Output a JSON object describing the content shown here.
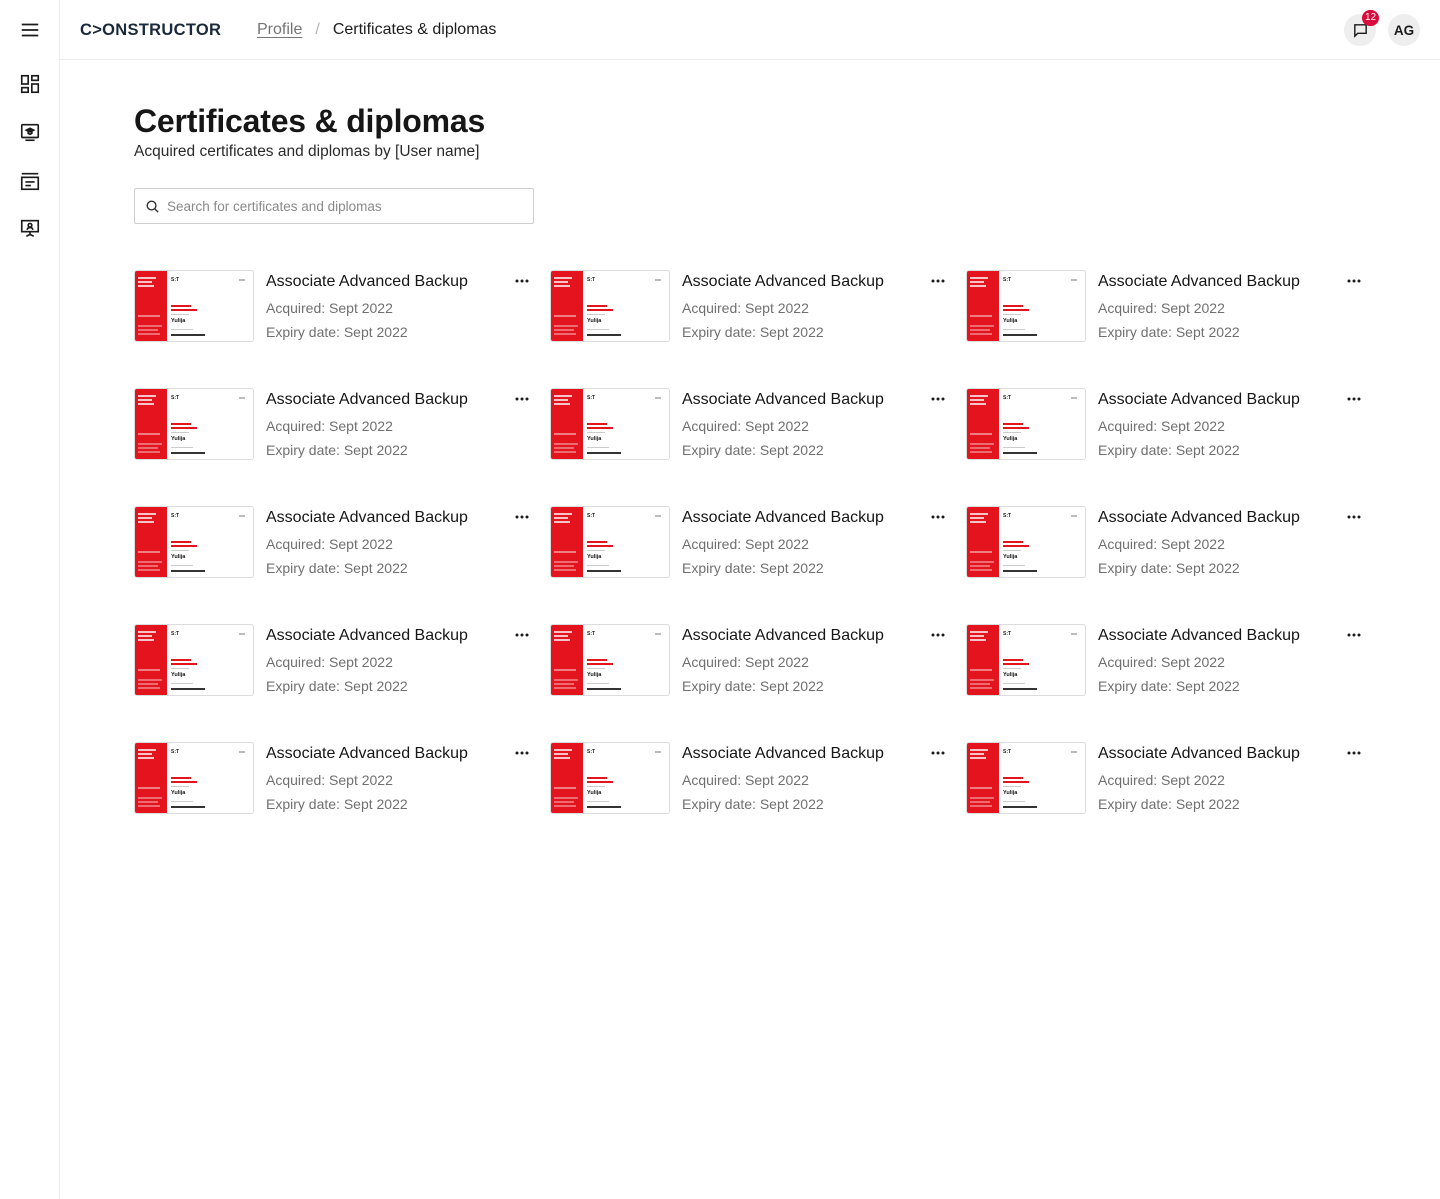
{
  "header": {
    "logo": "C>ONSTRUCTOR",
    "breadcrumb": {
      "parent": "Profile",
      "separator": "/",
      "current": "Certificates & diplomas"
    },
    "notifications_count": "12",
    "avatar_initials": "AG"
  },
  "page": {
    "title": "Certificates & diplomas",
    "subtitle": "Acquired certificates and diplomas by [User name]"
  },
  "search": {
    "placeholder": "Search for certificates and diplomas",
    "value": ""
  },
  "colors": {
    "accent": "#e3141e",
    "badge": "#d80b3c",
    "brand": "#1b2a3a"
  },
  "certificates": [
    {
      "title": "Associate Advanced Backup",
      "acquired": "Acquired: Sept 2022",
      "expiry": "Expiry date: Sept 2022",
      "thumb_logo": "S:T",
      "thumb_name": "Yulija"
    },
    {
      "title": "Associate Advanced Backup",
      "acquired": "Acquired: Sept 2022",
      "expiry": "Expiry date: Sept 2022",
      "thumb_logo": "S:T",
      "thumb_name": "Yulija"
    },
    {
      "title": "Associate Advanced Backup",
      "acquired": "Acquired: Sept 2022",
      "expiry": "Expiry date: Sept 2022",
      "thumb_logo": "S:T",
      "thumb_name": "Yulija"
    },
    {
      "title": "Associate Advanced Backup",
      "acquired": "Acquired: Sept 2022",
      "expiry": "Expiry date: Sept 2022",
      "thumb_logo": "S:T",
      "thumb_name": "Yulija"
    },
    {
      "title": "Associate Advanced Backup",
      "acquired": "Acquired: Sept 2022",
      "expiry": "Expiry date: Sept 2022",
      "thumb_logo": "S:T",
      "thumb_name": "Yulija"
    },
    {
      "title": "Associate Advanced Backup",
      "acquired": "Acquired: Sept 2022",
      "expiry": "Expiry date: Sept 2022",
      "thumb_logo": "S:T",
      "thumb_name": "Yulija"
    },
    {
      "title": "Associate Advanced Backup",
      "acquired": "Acquired: Sept 2022",
      "expiry": "Expiry date: Sept 2022",
      "thumb_logo": "S:T",
      "thumb_name": "Yulija"
    },
    {
      "title": "Associate Advanced Backup",
      "acquired": "Acquired: Sept 2022",
      "expiry": "Expiry date: Sept 2022",
      "thumb_logo": "S:T",
      "thumb_name": "Yulija"
    },
    {
      "title": "Associate Advanced Backup",
      "acquired": "Acquired: Sept 2022",
      "expiry": "Expiry date: Sept 2022",
      "thumb_logo": "S:T",
      "thumb_name": "Yulija"
    },
    {
      "title": "Associate Advanced Backup",
      "acquired": "Acquired: Sept 2022",
      "expiry": "Expiry date: Sept 2022",
      "thumb_logo": "S:T",
      "thumb_name": "Yulija"
    },
    {
      "title": "Associate Advanced Backup",
      "acquired": "Acquired: Sept 2022",
      "expiry": "Expiry date: Sept 2022",
      "thumb_logo": "S:T",
      "thumb_name": "Yulija"
    },
    {
      "title": "Associate Advanced Backup",
      "acquired": "Acquired: Sept 2022",
      "expiry": "Expiry date: Sept 2022",
      "thumb_logo": "S:T",
      "thumb_name": "Yulija"
    },
    {
      "title": "Associate Advanced Backup",
      "acquired": "Acquired: Sept 2022",
      "expiry": "Expiry date: Sept 2022",
      "thumb_logo": "S:T",
      "thumb_name": "Yulija"
    },
    {
      "title": "Associate Advanced Backup",
      "acquired": "Acquired: Sept 2022",
      "expiry": "Expiry date: Sept 2022",
      "thumb_logo": "S:T",
      "thumb_name": "Yulija"
    },
    {
      "title": "Associate Advanced Backup",
      "acquired": "Acquired: Sept 2022",
      "expiry": "Expiry date: Sept 2022",
      "thumb_logo": "S:T",
      "thumb_name": "Yulija"
    }
  ]
}
